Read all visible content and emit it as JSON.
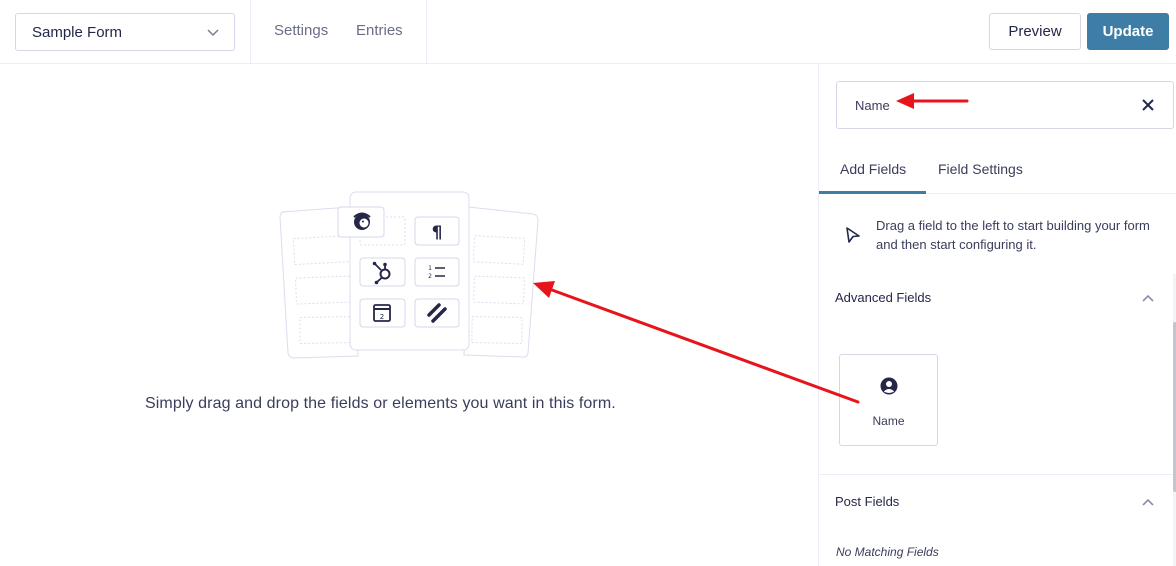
{
  "header": {
    "form_selector": {
      "value": "Sample Form",
      "icon": "chevron-down-icon"
    },
    "nav": [
      {
        "label": "Settings"
      },
      {
        "label": "Entries"
      }
    ],
    "preview_label": "Preview",
    "update_label": "Update"
  },
  "main": {
    "empty_state_text": "Simply drag and drop the fields or elements you want in this form.",
    "illustration_icons": [
      "mailchimp-icon",
      "paragraph-icon",
      "hubspot-icon",
      "numbered-list-icon",
      "calendar-icon",
      "stripe-slashes-icon"
    ],
    "illustration_calendar_day": "2",
    "illustration_list_numbers": [
      "1",
      "2"
    ]
  },
  "sidebar": {
    "search": {
      "value": "Name",
      "clear_icon": "close-icon"
    },
    "tabs": [
      {
        "label": "Add Fields",
        "active": true
      },
      {
        "label": "Field Settings",
        "active": false
      }
    ],
    "hint": "Drag a field to the left to start building your form and then start configuring it.",
    "sections": [
      {
        "title": "Advanced Fields",
        "expanded": true,
        "fields": [
          {
            "label": "Name",
            "icon": "user-circle-icon"
          }
        ]
      },
      {
        "title": "Post Fields",
        "expanded": true,
        "empty_text": "No Matching Fields"
      }
    ]
  },
  "colors": {
    "accent": "#3e7da6",
    "text": "#242748",
    "muted": "#6b6d88",
    "border": "#d5d7e9",
    "annotation": "#e8141b"
  }
}
